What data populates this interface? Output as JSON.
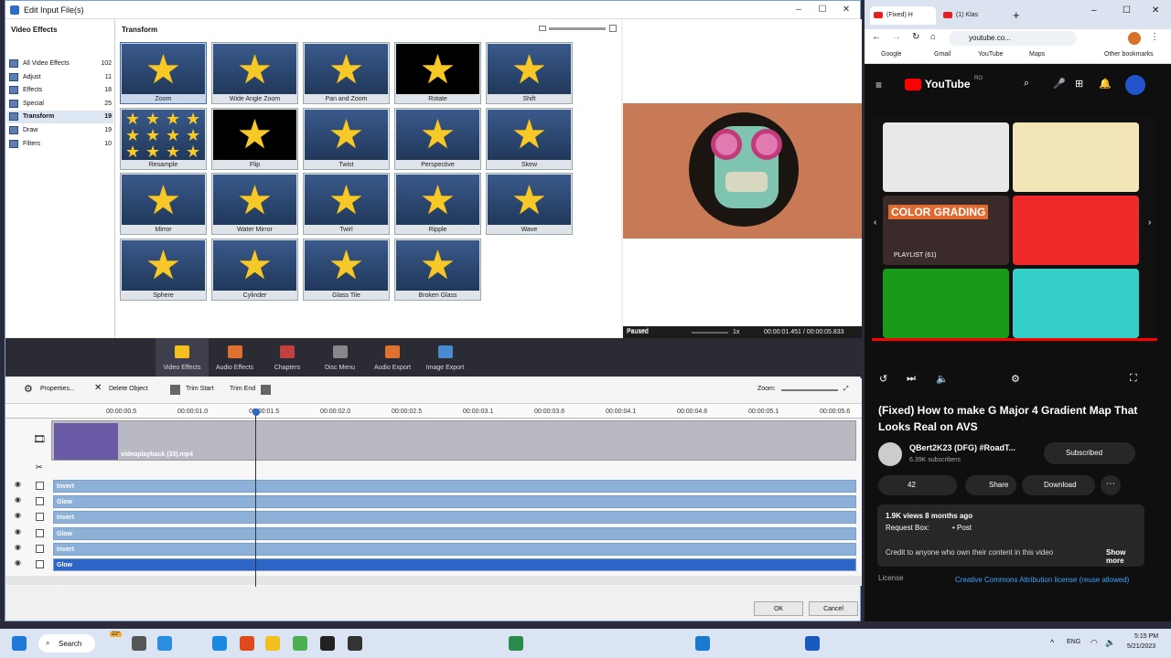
{
  "editor": {
    "title": "Edit Input File(s)",
    "left_header": "Video Effects",
    "grid_header": "Transform",
    "categories": [
      {
        "label": "All Video Effects",
        "count": "102"
      },
      {
        "label": "Adjust",
        "count": "11"
      },
      {
        "label": "Effects",
        "count": "18"
      },
      {
        "label": "Special",
        "count": "25"
      },
      {
        "label": "Transform",
        "count": "19"
      },
      {
        "label": "Draw",
        "count": "19"
      },
      {
        "label": "Filters",
        "count": "10"
      }
    ],
    "effects": [
      "Zoom",
      "Wide Angle Zoom",
      "Pan and Zoom",
      "Rotate",
      "Shift",
      "Resample",
      "Flip",
      "Twist",
      "Perspective",
      "Skew",
      "Mirror",
      "Water Mirror",
      "Twirl",
      "Ripple",
      "Wave",
      "Sphere",
      "Cylinder",
      "Glass Tile",
      "Broken Glass"
    ],
    "preview": {
      "status": "Paused",
      "speed": "1x",
      "time": "00:00:01.451 / 00:00:05.833"
    },
    "tabs": [
      "Video Effects",
      "Audio Effects",
      "Chapters",
      "Disc Menu",
      "Audio Export",
      "Image Export"
    ],
    "toolbar": {
      "properties": "Properties...",
      "delete": "Delete Object",
      "trim_start": "Trim Start",
      "trim_end": "Trim End",
      "zoom": "Zoom:"
    },
    "ruler": [
      "00:00:00.5",
      "00:00:01.0",
      "00:00:01.5",
      "00:00:02.0",
      "00:00:02.5",
      "00:00:03.1",
      "00:00:03.6",
      "00:00:04.1",
      "00:00:04.6",
      "00:00:05.1",
      "00:00:05.6"
    ],
    "clip_name": "videoplayback (33).mp4",
    "fx_tracks": [
      "Invert",
      "Glow",
      "Invert",
      "Glow",
      "Invert",
      "Glow"
    ],
    "ok": "OK",
    "cancel": "Cancel"
  },
  "chrome": {
    "tabs": [
      "(Fixed) H",
      "(1) Klas"
    ],
    "url": "youtube.co...",
    "bookmarks": [
      "Google",
      "Gmail",
      "YouTube",
      "Maps"
    ],
    "other_bookmarks": "Other bookmarks",
    "brand": "YouTube",
    "brand_region": "RO",
    "playlist": "PLAYLIST (61)",
    "thumb_text": "COLOR GRADING",
    "video_title": "(Fixed) How to make G Major 4 Gradient Map That Looks Real on AVS",
    "channel": "QBert2K23 (DFG) #RoadT...",
    "subscribers": "6.39K subscribers",
    "subscribed": "Subscribed",
    "likes": "42",
    "share": "Share",
    "download": "Download",
    "views": "1.9K views  8 months ago",
    "request": "Request Box:",
    "post": "• Post",
    "credit": "Credit to anyone who own their content in this video",
    "show_more": "Show more",
    "license_label": "License",
    "license_value": "Creative Commons Attribution license (reuse allowed)"
  },
  "taskbar": {
    "search": "Search",
    "lang": "ENG",
    "time": "5:15 PM",
    "date": "5/21/2023",
    "badge": "22°"
  }
}
